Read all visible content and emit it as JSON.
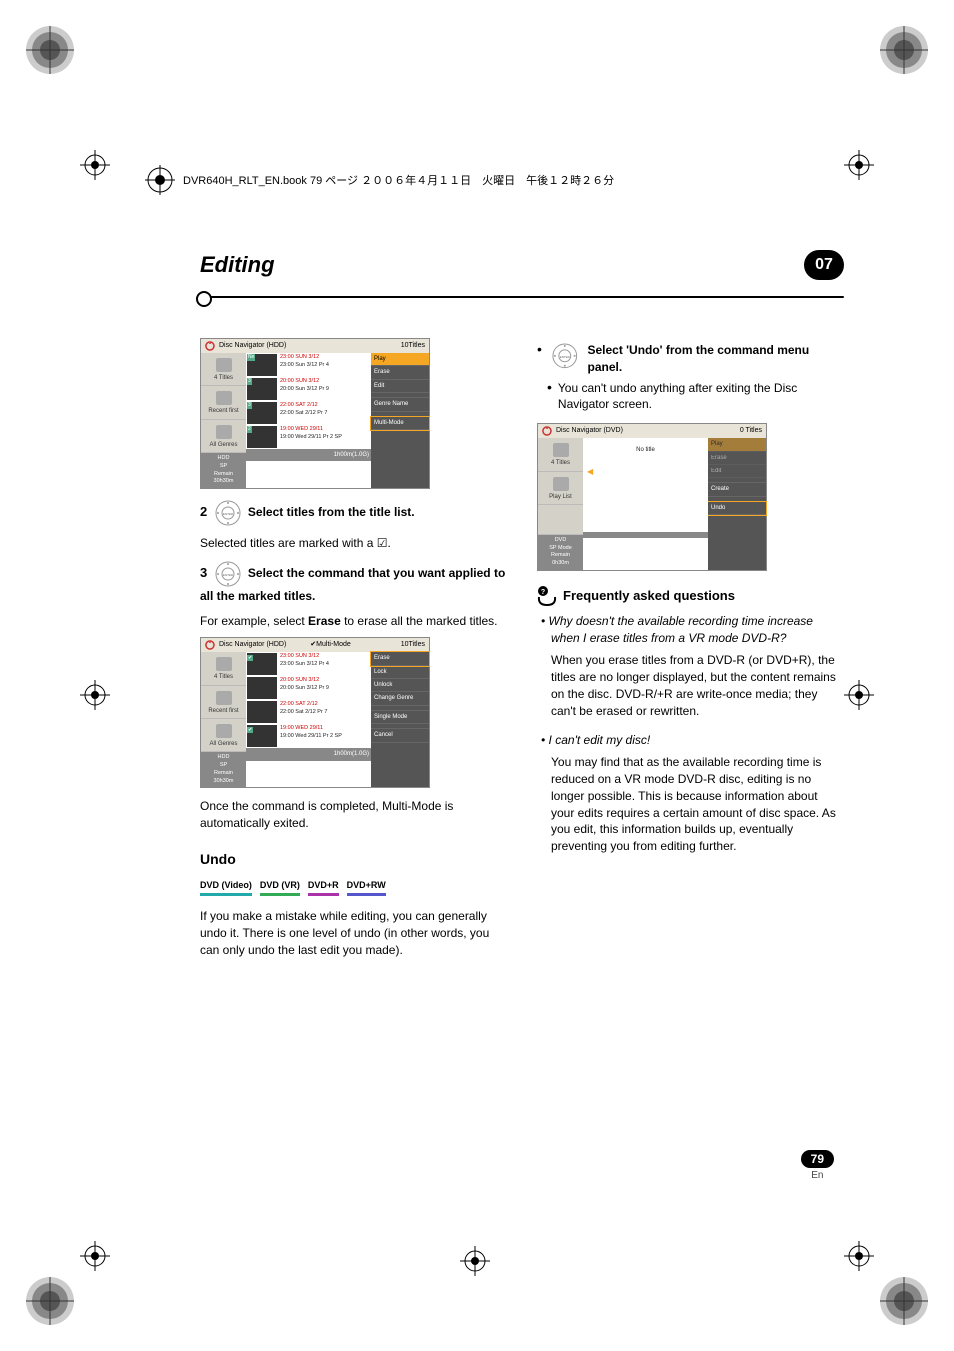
{
  "bookline": "DVR640H_RLT_EN.book  79 ページ  ２００６年４月１１日　火曜日　午後１２時２６分",
  "chapter": {
    "title": "Editing",
    "num": "07"
  },
  "nav1": {
    "header": "Disc Navigator (HDD)",
    "header_right": "10Titles",
    "side": {
      "a": "4 Titles",
      "b": "Recent first",
      "c": "All Genres",
      "mode": "HDD",
      "sp": "SP",
      "remain": "Remain",
      "remain_val": "30h30m"
    },
    "rows": [
      {
        "badge": "Ne",
        "d1": "23:00 SUN  3/12",
        "d2": "23:00  Sun  3/12  Pr 4"
      },
      {
        "badge": "3",
        "d1": "20:00 SUN  3/12",
        "d2": "20:00  Sun  3/12  Pr 9"
      },
      {
        "badge": "3",
        "d1": "22:00 SAT  2/12",
        "d2": "22:00  Sat  2/12  Pr 7"
      },
      {
        "badge": "2",
        "d1": "19:00 WED 29/11",
        "d2": "19:00  Wed  29/11  Pr 2  SP"
      }
    ],
    "menu": [
      "Play",
      "Erase",
      "Edit",
      "",
      "Genre Name",
      "",
      "Multi-Mode"
    ],
    "footer": "1h00m(1.0G)"
  },
  "step2": {
    "num": "2",
    "text": "Select titles from the title list.",
    "sub": "Selected titles are marked with a ☑."
  },
  "step3": {
    "num": "3",
    "text": "Select the command that you want applied to all the marked titles.",
    "sub_a": "For example, select ",
    "sub_b": "Erase",
    "sub_c": " to erase all the marked titles."
  },
  "nav2": {
    "header": "Disc Navigator (HDD)",
    "header_mid": "Multi-Mode",
    "header_right": "10Titles",
    "side": {
      "a": "4 Titles",
      "b": "Recent first",
      "c": "All Genres",
      "mode": "HDD",
      "sp": "SP",
      "remain": "Remain",
      "remain_val": "30h30m"
    },
    "rows": [
      {
        "chk": true,
        "d1": "23:00 SUN  3/12",
        "d2": "23:00  Sun  3/12  Pr 4"
      },
      {
        "chk": false,
        "d1": "20:00 SUN  3/12",
        "d2": "20:00  Sun  3/12  Pr 9"
      },
      {
        "chk": false,
        "d1": "22:00 SAT  2/12",
        "d2": "22:00  Sat  2/12  Pr 7"
      },
      {
        "chk": true,
        "d1": "19:00 WED 29/11",
        "d2": "19:00  Wed  29/11  Pr 2  SP"
      }
    ],
    "menu": [
      "Erase",
      "Lock",
      "Unlock",
      "Change Genre",
      "",
      "Single Mode",
      "",
      "Cancel"
    ],
    "footer": "1h00m(1.0G)"
  },
  "after_nav2": "Once the command is completed, Multi-Mode is automatically exited.",
  "undo": {
    "h": "Undo",
    "modes": [
      "DVD (Video)",
      "DVD (VR)",
      "DVD+R",
      "DVD+RW"
    ],
    "para": "If you make a mistake while editing, you can generally undo it. There is one level of undo (in other words, you can only undo the last edit you made)."
  },
  "col2": {
    "step": {
      "text": "Select 'Undo' from the command menu panel."
    },
    "sub": "You can't undo anything after exiting the Disc Navigator screen."
  },
  "nav3": {
    "header": "Disc Navigator (DVD)",
    "header_right": "0 Titles",
    "side": {
      "a": "4 Titles",
      "b": "Play List",
      "mode": "DVD",
      "sp": "SP Mode",
      "remain": "Remain",
      "remain_val": "0h30m"
    },
    "rows": [
      {
        "d1": "No title"
      }
    ],
    "menu": [
      "Play",
      "Erase",
      "Edit",
      "",
      "Create",
      "",
      "Undo"
    ]
  },
  "faq": {
    "h": "Frequently asked questions",
    "q1": "Why doesn't the available recording time increase when I erase titles from a VR mode DVD-R?",
    "a1": "When you erase titles from a DVD-R (or DVD+R), the titles are no longer displayed, but the content remains on the disc. DVD-R/+R are write-once media; they can't be erased or rewritten.",
    "q2": "I can't edit my disc!",
    "a2": "You may find that as the available recording time is reduced on a VR mode DVD-R disc, editing is no longer possible. This is because information about your edits requires a certain amount of disc space. As you edit, this information builds up, eventually preventing you from editing further."
  },
  "page": {
    "num": "79",
    "lang": "En"
  },
  "icons": {
    "enter": "ENTER"
  }
}
